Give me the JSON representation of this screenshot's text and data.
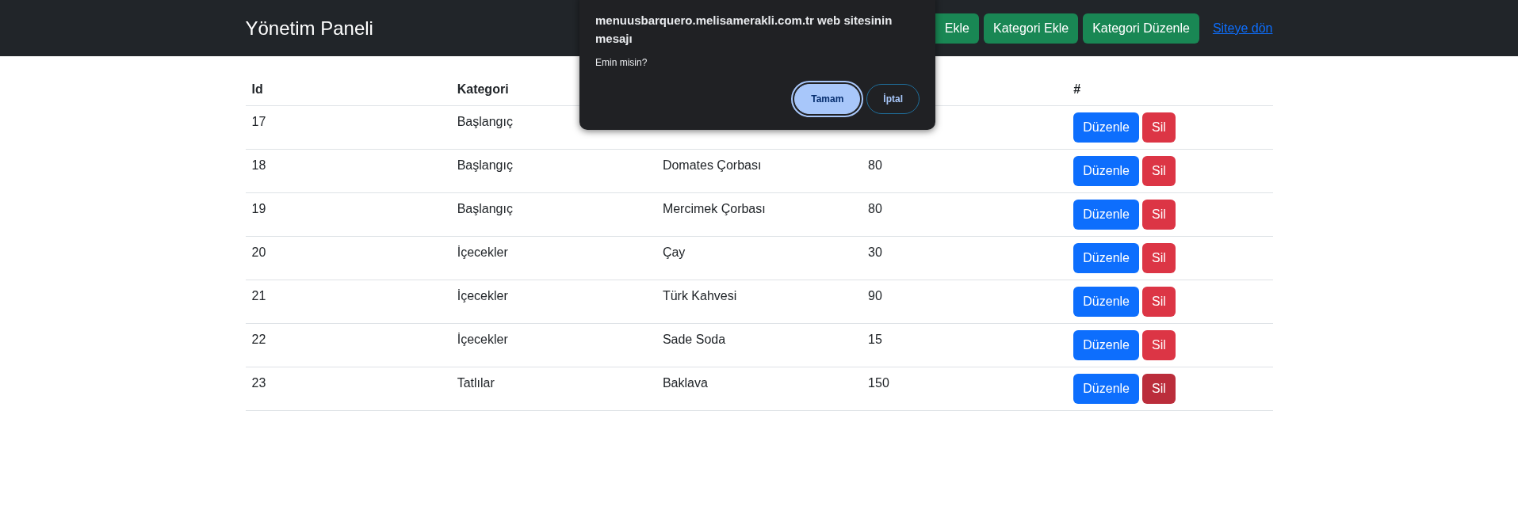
{
  "navbar": {
    "title": "Yönetim Paneli",
    "buttons": [
      "Ekle",
      "Kategori Ekle",
      "Kategori Düzenle"
    ],
    "link": "Siteye dön"
  },
  "table": {
    "columns": [
      "Id",
      "Kategori",
      "#"
    ],
    "rows": [
      {
        "id": "17",
        "category": "Başlangıç",
        "edit": "Düzenle",
        "delete": "Sil",
        "delete_hovered": false
      },
      {
        "id": "18",
        "category": "Başlangıç",
        "name": "Domates Çorbası",
        "price": "80",
        "edit": "Düzenle",
        "delete": "Sil",
        "delete_hovered": false
      },
      {
        "id": "19",
        "category": "Başlangıç",
        "name": "Mercimek Çorbası",
        "price": "80",
        "edit": "Düzenle",
        "delete": "Sil",
        "delete_hovered": false
      },
      {
        "id": "20",
        "category": "İçecekler",
        "name": "Çay",
        "price": "30",
        "edit": "Düzenle",
        "delete": "Sil",
        "delete_hovered": false
      },
      {
        "id": "21",
        "category": "İçecekler",
        "name": "Türk Kahvesi",
        "price": "90",
        "edit": "Düzenle",
        "delete": "Sil",
        "delete_hovered": false
      },
      {
        "id": "22",
        "category": "İçecekler",
        "name": "Sade Soda",
        "price": "15",
        "edit": "Düzenle",
        "delete": "Sil",
        "delete_hovered": false
      },
      {
        "id": "23",
        "category": "Tatlılar",
        "name": "Baklava",
        "price": "150",
        "edit": "Düzenle",
        "delete": "Sil",
        "delete_hovered": true
      }
    ]
  },
  "dialog": {
    "title": "menuusbarquero.melisamerakli.com.tr web sitesinin mesajı",
    "message": "Emin misin?",
    "buttons": [
      {
        "label": "Tamam",
        "kind": "primary",
        "focused": true
      },
      {
        "label": "İptal",
        "kind": "secondary",
        "focused": false
      }
    ]
  }
}
